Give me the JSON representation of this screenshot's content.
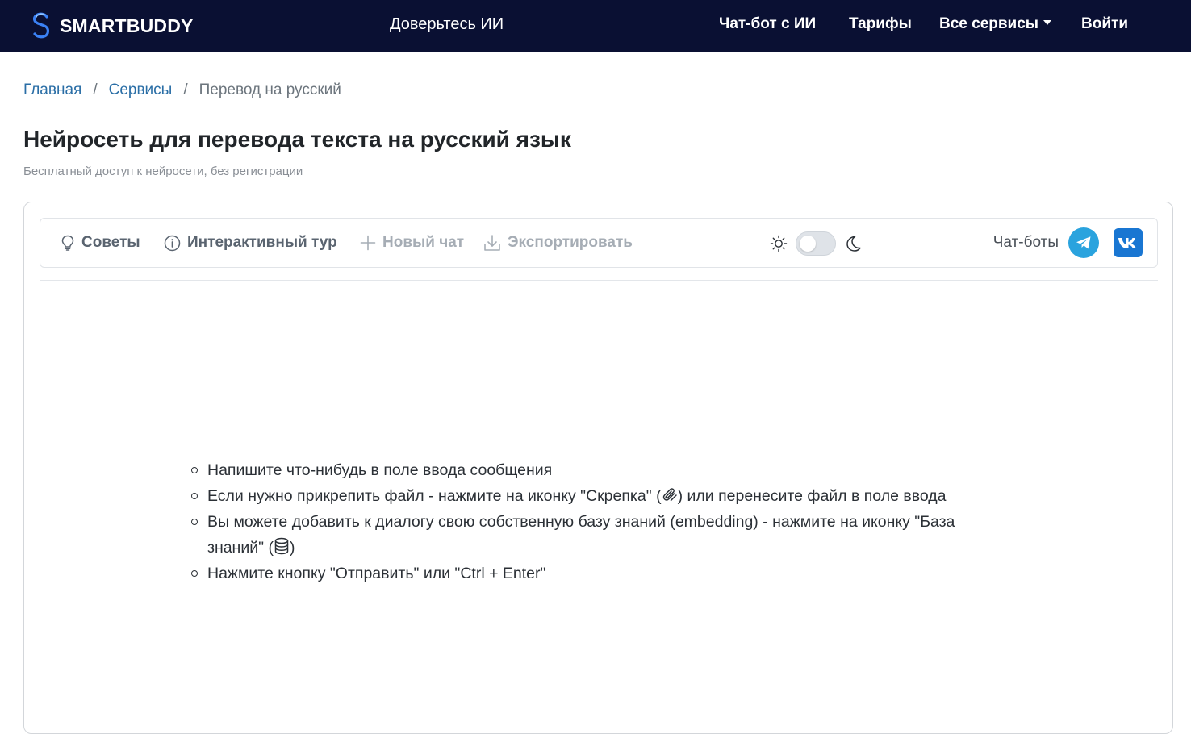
{
  "header": {
    "brand": "SMARTBUDDY",
    "tagline": "Доверьтесь ИИ",
    "nav": [
      {
        "label": "Чат-бот с ИИ"
      },
      {
        "label": "Тарифы"
      },
      {
        "label": "Все сервисы",
        "dropdown": true
      },
      {
        "label": "Войти"
      }
    ]
  },
  "breadcrumb": {
    "items": [
      {
        "label": "Главная"
      },
      {
        "label": "Сервисы"
      },
      {
        "label": "Перевод на русский"
      }
    ],
    "separator": "/"
  },
  "page": {
    "title": "Нейросеть для перевода текста на русский язык",
    "subtitle": "Бесплатный доступ к нейросети, без регистрации"
  },
  "toolbar": {
    "tips": "Советы",
    "tour": "Интерактивный тур",
    "new_chat": "Новый чат",
    "export": "Экспортировать",
    "bots_label": "Чат-боты",
    "theme": {
      "mode": "light"
    }
  },
  "tips": {
    "item1": "Напишите что-нибудь в поле ввода сообщения",
    "item2_before": "Если нужно прикрепить файл - нажмите на иконку \"Скрепка\" (",
    "item2_after": ") или перенесите файл в поле ввода",
    "item3_before": "Вы можете добавить к диалогу свою собственную базу знаний (embedding) - нажмите на иконку \"База знаний\" (",
    "item3_after": ")",
    "item4": "Нажмите кнопку \"Отправить\" или \"Ctrl + Enter\""
  },
  "colors": {
    "header_bg": "#0a1033",
    "link": "#2a6ea6",
    "telegram": "#2aa3de",
    "vk": "#1976d2"
  },
  "icons": {
    "logo": "smartbuddy-s-logo",
    "tips": "lightbulb-icon",
    "tour": "info-circle-icon",
    "new_chat": "plus-icon",
    "export": "download-icon",
    "light": "sun-icon",
    "dark": "moon-icon",
    "telegram": "telegram-icon",
    "vk": "vk-icon",
    "paperclip": "paperclip-icon",
    "database": "database-icon"
  }
}
